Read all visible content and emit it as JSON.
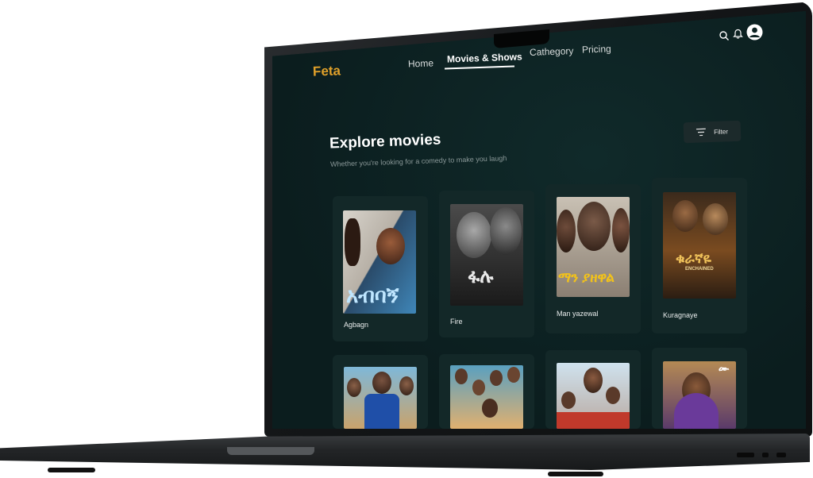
{
  "app": {
    "brand": "Feta"
  },
  "nav": {
    "items": [
      {
        "label": "Home"
      },
      {
        "label": "Movies & Shows"
      },
      {
        "label": "Cathegory"
      },
      {
        "label": "Pricing"
      }
    ],
    "active": "Movies & Shows"
  },
  "header_icons": [
    "search-icon",
    "bell-icon",
    "user-avatar-icon"
  ],
  "explore": {
    "title": "Explore movies",
    "subtitle": "Whether you're looking for a comedy to make you laugh",
    "filter_label": "Filter"
  },
  "movies": [
    {
      "title": "Agbagn",
      "poster_text": "አብባኝ"
    },
    {
      "title": "Fire",
      "poster_text": "ፋሉ"
    },
    {
      "title": "Man yazewal",
      "poster_text": "ማን ያዘዋል"
    },
    {
      "title": "Kuragnaye",
      "poster_text": "ቁራኛዬ",
      "poster_subtext": "ENCHAINED"
    },
    {
      "title": ""
    },
    {
      "title": ""
    },
    {
      "title": ""
    },
    {
      "title": "",
      "poster_text": "ሙ"
    }
  ],
  "colors": {
    "brand": "#e0a02a",
    "screen_bg": "#0d2222",
    "card_bg": "#132828",
    "text": "#ffffff",
    "muted": "#8a9898"
  }
}
